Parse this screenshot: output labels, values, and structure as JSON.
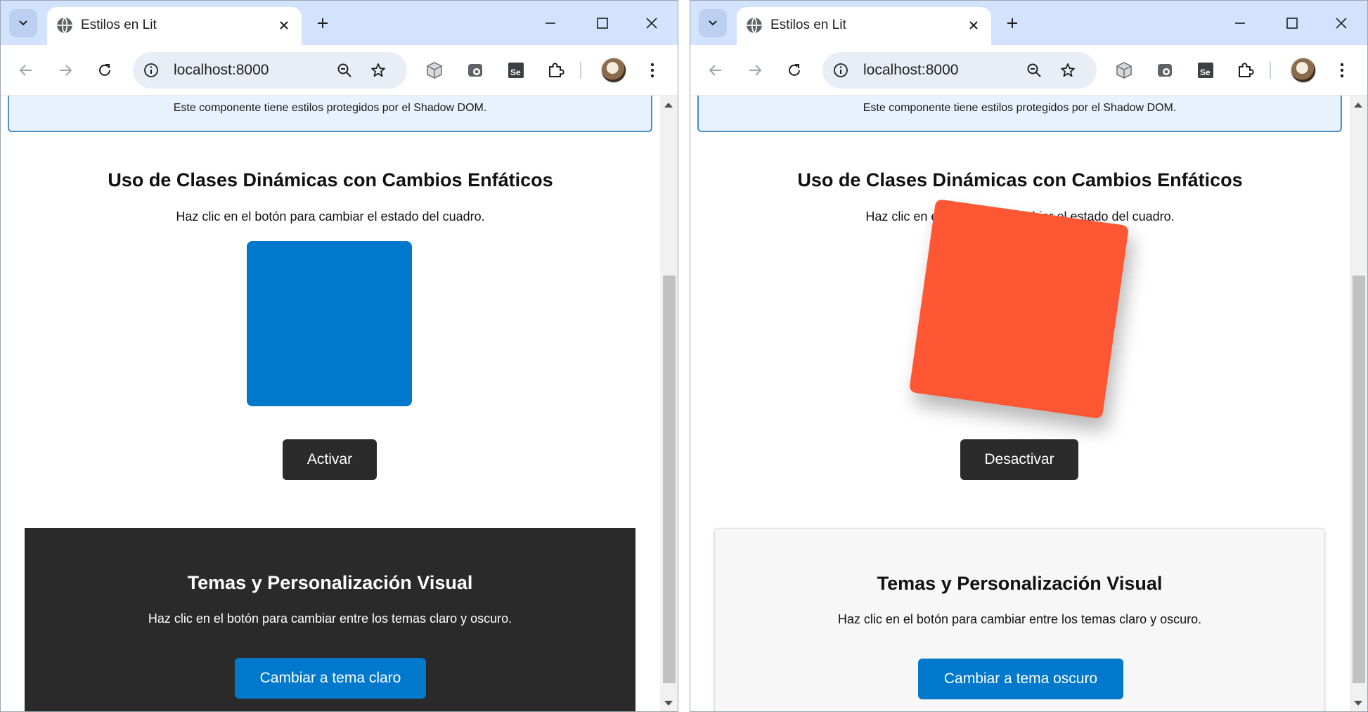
{
  "browser": {
    "tab_title": "Estilos en Lit",
    "url": "localhost:8000"
  },
  "page": {
    "shadow_note": "Este componente tiene estilos protegidos por el Shadow DOM.",
    "dynamic": {
      "title": "Uso de Clases Dinámicas con Cambios Enfáticos",
      "description": "Haz clic en el botón para cambiar el estado del cuadro."
    },
    "themes": {
      "title": "Temas y Personalización Visual",
      "description": "Haz clic en el botón para cambiar entre los temas claro y oscuro."
    }
  },
  "left": {
    "box_state": "inactive",
    "box_color": "#0078cc",
    "toggle_button": "Activar",
    "theme": "dark",
    "theme_button": "Cambiar a tema claro"
  },
  "right": {
    "box_state": "active",
    "box_color": "#ff5733",
    "toggle_button": "Desactivar",
    "theme": "light",
    "theme_button": "Cambiar a tema oscuro"
  },
  "colors": {
    "titlebar": "#d3e3fd",
    "accent_blue": "#0078cc",
    "dark_button": "#2b2b2b",
    "dark_theme_bg": "#2a2a2a",
    "light_theme_bg": "#f7f7f7"
  },
  "icons": [
    "tab-search-icon",
    "globe-icon",
    "close-icon",
    "plus-icon",
    "minimize-icon",
    "maximize-icon",
    "back-icon",
    "forward-icon",
    "reload-icon",
    "site-info-icon",
    "zoom-icon",
    "star-icon",
    "cube-extension-icon",
    "devtools-extension-icon",
    "selenium-extension-icon",
    "puzzle-extension-icon",
    "kebab-menu-icon"
  ]
}
